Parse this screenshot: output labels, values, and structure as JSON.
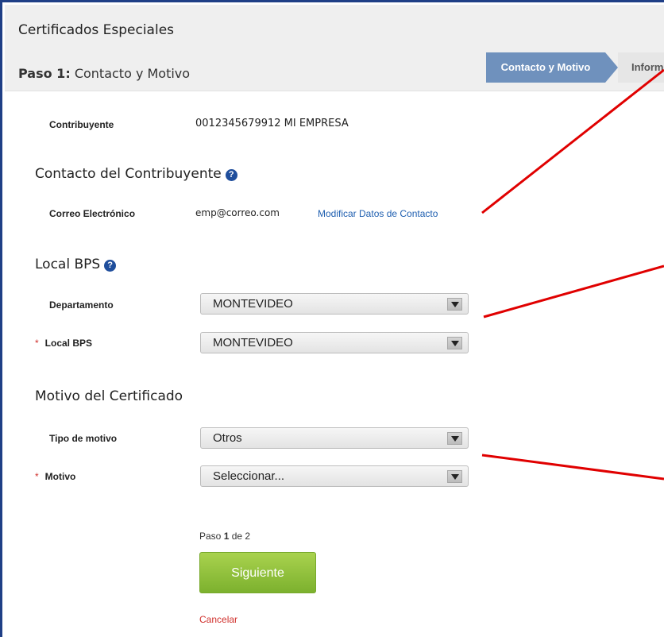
{
  "header": {
    "app_title": "Certificados Especiales",
    "step_prefix": "Paso 1:",
    "step_name": "Contacto y Motivo"
  },
  "wizard": {
    "active_step": "Contacto y Motivo",
    "next_step": "Inform"
  },
  "taxpayer": {
    "label": "Contribuyente",
    "value": "0012345679912 MI EMPRESA"
  },
  "contact_section": {
    "title": "Contacto del Contribuyente",
    "email_label": "Correo Electrónico",
    "email_value": "emp@correo.com",
    "modify_link": "Modificar Datos de Contacto"
  },
  "local_section": {
    "title": "Local BPS",
    "department_label": "Departamento",
    "department_value": "MONTEVIDEO",
    "local_label": "Local BPS",
    "local_value": "MONTEVIDEO",
    "required_mark": "*"
  },
  "motive_section": {
    "title": "Motivo del Certificado",
    "type_label": "Tipo de motivo",
    "type_value": "Otros",
    "motive_label": "Motivo",
    "motive_value": "Seleccionar...",
    "required_mark": "*"
  },
  "footer": {
    "step_word": "Paso",
    "step_current": "1",
    "step_of": "de 2",
    "next_button": "Siguiente",
    "cancel_link": "Cancelar"
  },
  "colors": {
    "frame_border": "#1f3f86",
    "wizard_active": "#6f91bd",
    "next_button": "#8cc03a",
    "annotation_lines": "#e00000",
    "required_mark": "#d0312d",
    "link": "#1f5fb0"
  },
  "icons": {
    "help": "question-circle-icon",
    "dropdown": "chevron-down-icon"
  }
}
